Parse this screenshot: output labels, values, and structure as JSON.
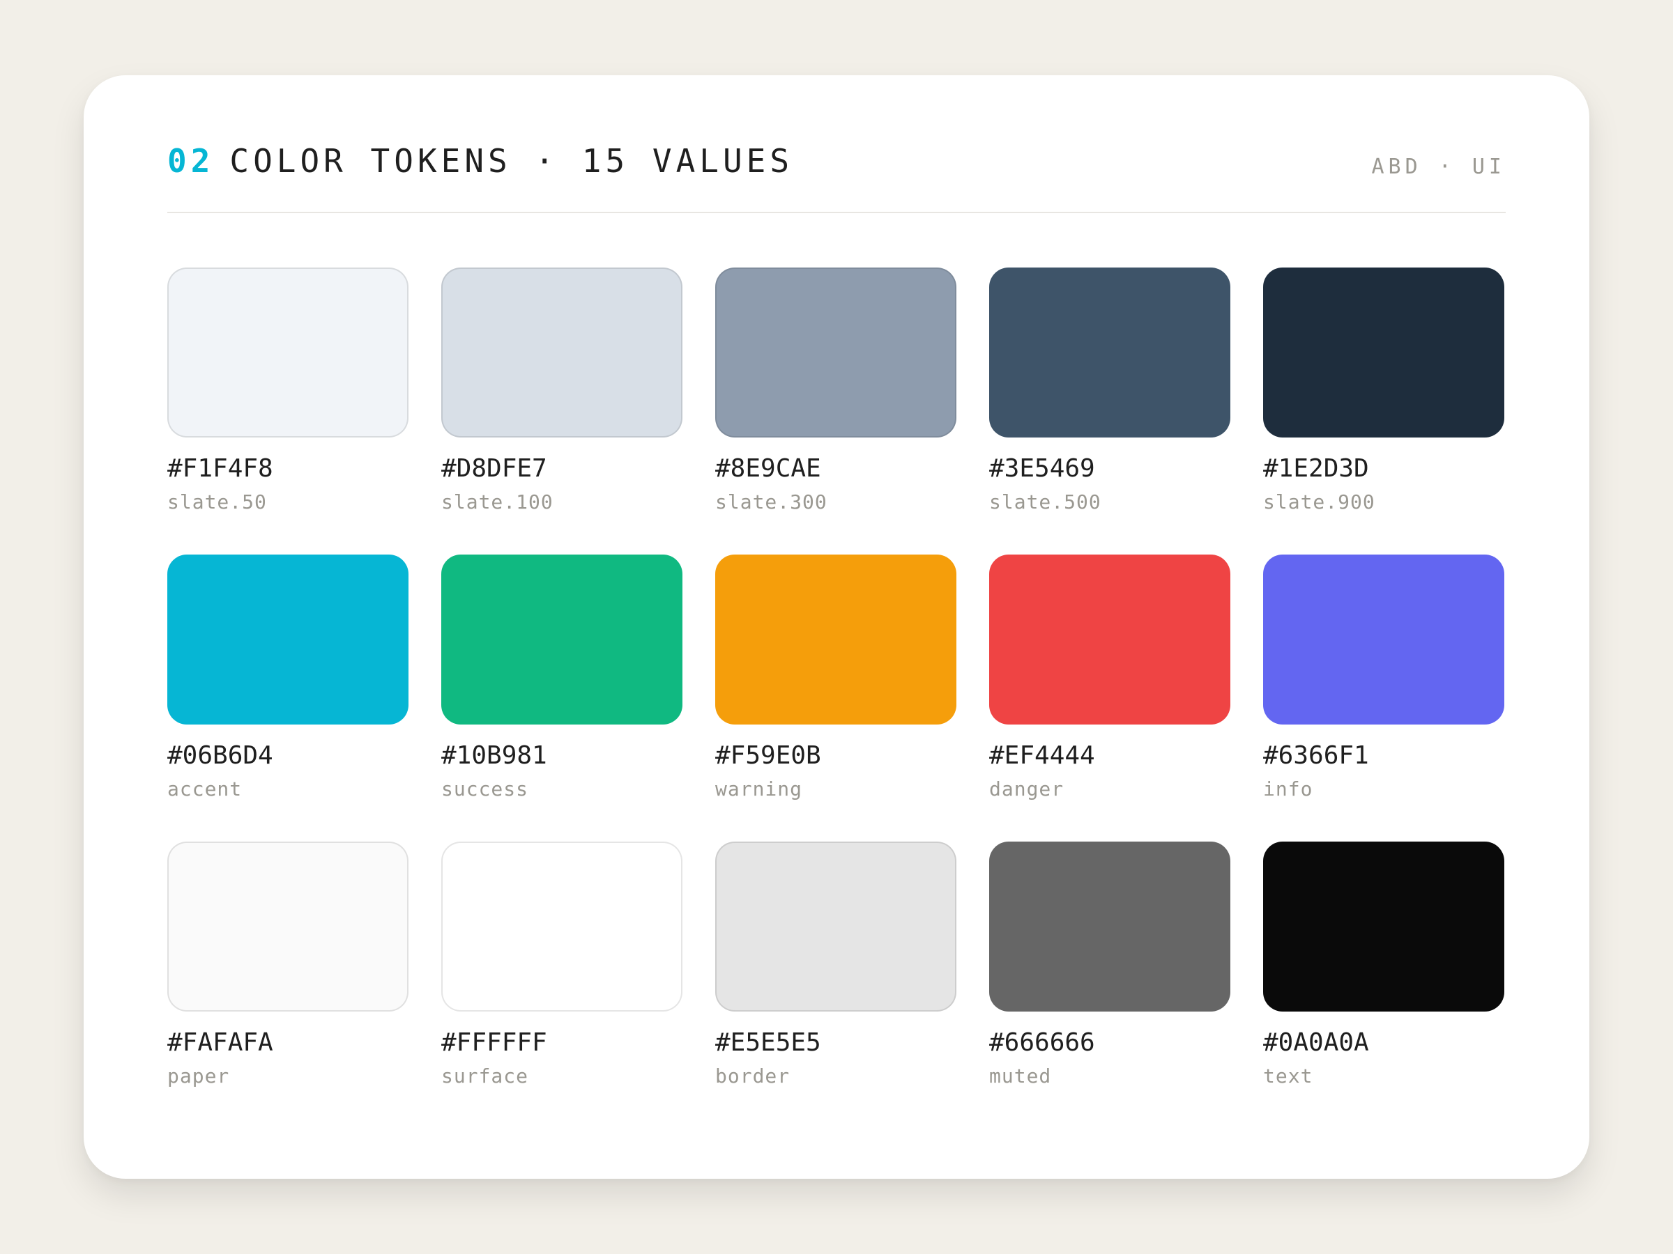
{
  "header": {
    "section_number": "02",
    "section_title": "COLOR TOKENS · 15 VALUES",
    "brand": "ABD · UI",
    "accent_color": "#06B6D4"
  },
  "swatches": [
    {
      "hex": "#F1F4F8",
      "token": "slate.50",
      "color": "#F1F4F8",
      "outlined": true
    },
    {
      "hex": "#D8DFE7",
      "token": "slate.100",
      "color": "#D8DFE7",
      "outlined": true
    },
    {
      "hex": "#8E9CAE",
      "token": "slate.300",
      "color": "#8E9CAE",
      "outlined": true
    },
    {
      "hex": "#3E5469",
      "token": "slate.500",
      "color": "#3E5469",
      "outlined": false
    },
    {
      "hex": "#1E2D3D",
      "token": "slate.900",
      "color": "#1E2D3D",
      "outlined": false
    },
    {
      "hex": "#06B6D4",
      "token": "accent",
      "color": "#06B6D4",
      "outlined": false
    },
    {
      "hex": "#10B981",
      "token": "success",
      "color": "#10B981",
      "outlined": false
    },
    {
      "hex": "#F59E0B",
      "token": "warning",
      "color": "#F59E0B",
      "outlined": false
    },
    {
      "hex": "#EF4444",
      "token": "danger",
      "color": "#EF4444",
      "outlined": false
    },
    {
      "hex": "#6366F1",
      "token": "info",
      "color": "#6366F1",
      "outlined": false
    },
    {
      "hex": "#FAFAFA",
      "token": "paper",
      "color": "#FAFAFA",
      "outlined": true
    },
    {
      "hex": "#FFFFFF",
      "token": "surface",
      "color": "#FFFFFF",
      "outlined": true
    },
    {
      "hex": "#E5E5E5",
      "token": "border",
      "color": "#E5E5E5",
      "outlined": true
    },
    {
      "hex": "#666666",
      "token": "muted",
      "color": "#666666",
      "outlined": false
    },
    {
      "hex": "#0A0A0A",
      "token": "text",
      "color": "#0A0A0A",
      "outlined": false
    }
  ]
}
